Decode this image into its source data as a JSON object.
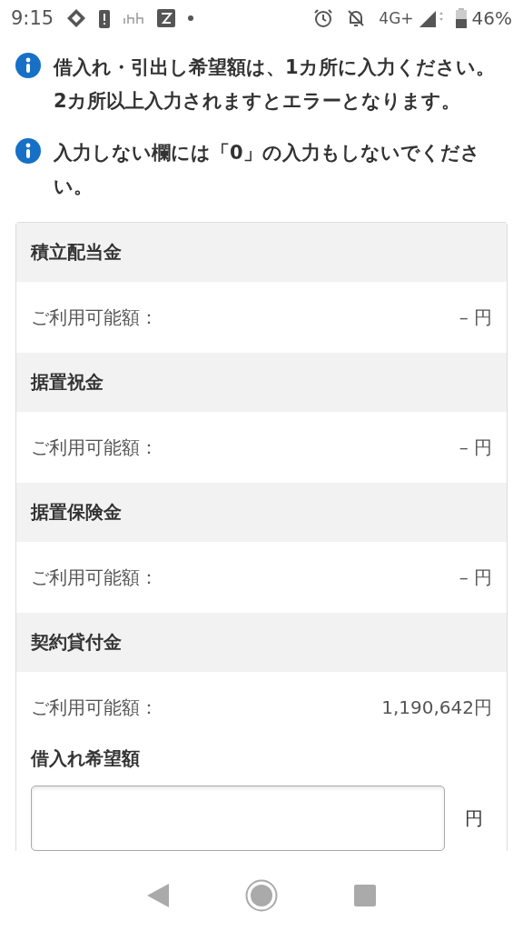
{
  "status_bar": {
    "time": "9:15",
    "network": "4G+",
    "battery": "46%"
  },
  "notices": [
    "借入れ・引出し希望額は、1カ所に入力ください。2カ所以上入力されますとエラーとなります。",
    "入力しない欄には「0」の入力もしないでください。"
  ],
  "sections": [
    {
      "title": "積立配当金",
      "label": "ご利用可能額：",
      "amount": "–",
      "unit": "円"
    },
    {
      "title": "据置祝金",
      "label": "ご利用可能額：",
      "amount": "–",
      "unit": "円"
    },
    {
      "title": "据置保険金",
      "label": "ご利用可能額：",
      "amount": "–",
      "unit": "円"
    },
    {
      "title": "契約貸付金",
      "label": "ご利用可能額：",
      "amount": "1,190,642",
      "unit": "円",
      "field": {
        "label": "借入れ希望額",
        "unit": "円"
      }
    }
  ]
}
